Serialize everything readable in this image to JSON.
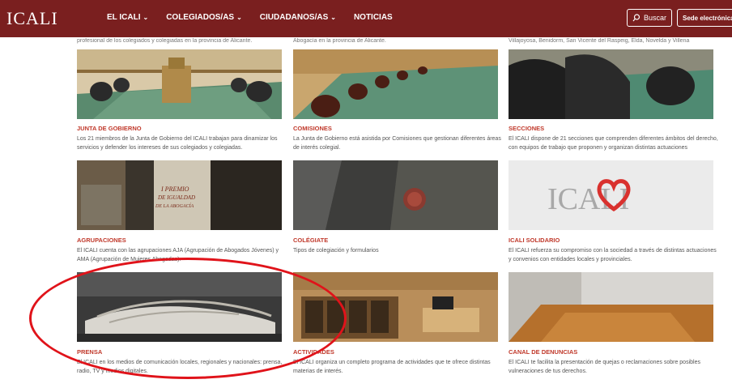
{
  "header": {
    "logo": "ICALI",
    "nav": [
      {
        "label": "EL ICALI",
        "chevron": true
      },
      {
        "label": "COLEGIADOS/AS",
        "chevron": true
      },
      {
        "label": "CIUDADANOS/AS",
        "chevron": true
      },
      {
        "label": "NOTICIAS",
        "chevron": false
      }
    ],
    "search_label": "Buscar",
    "sede_label": "Sede electrónica",
    "brand_color": "#7a1f1f"
  },
  "cards": [
    {
      "title": "JUNTA DE GOBIERNO",
      "desc": "Los 21 miembros de la Junta de Gobierno del ICALI trabajan para dinamizar los servicios y defender los intereses de sus colegiados y colegiadas."
    },
    {
      "title": "COMISIONES",
      "desc": "La Junta de Gobierno está asistida por Comisiones que gestionan diferentes áreas de interés colegial."
    },
    {
      "title": "SECCIONES",
      "desc": "El ICALI dispone de 21 secciones que comprenden diferentes ámbitos del derecho, con equipos de trabajo que proponen y organizan distintas actuaciones"
    },
    {
      "title": "AGRUPACIONES",
      "desc": "El ICALI cuenta con las agrupaciones AJA (Agrupación de Abogados Jóvenes) y AMA (Agrupación de Mujeres Abogadas)."
    },
    {
      "title": "COLÉGIATE",
      "desc": "Tipos de colegiación y formularios"
    },
    {
      "title": "ICALI SOLIDARIO",
      "desc": "El ICALI refuerza su compromiso con la sociedad a través de distintas actuaciones y convenios con entidades locales y provinciales."
    },
    {
      "title": "PRENSA",
      "desc": "El ICALI en los medios de comunicación locales, regionales y nacionales: prensa, radio, TV y medios digitales."
    },
    {
      "title": "ACTIVIDADES",
      "desc": "El ICALI organiza un completo programa de actividades que te ofrece distintas materias de interés."
    },
    {
      "title": "CANAL DE DENUNCIAS",
      "desc": "El ICALI te facilita la presentación de quejas o reclamaciones sobre posibles vulneraciones de tus derechos."
    }
  ],
  "image_texts": {
    "award_line1": "I PREMIO",
    "award_line2": "DE IGUALDAD",
    "award_line3": "DE LA ABOGACÍA",
    "solidario_logo": "ICALI"
  },
  "cut_texts": [
    "profesional de los colegiados y colegiadas en la provincia de Alicante.",
    "Abogacía en la provincia de Alicante.",
    "Villajoyosa, Benidorm, San Vicente del Raspeig, Elda, Novelda y Villena"
  ]
}
